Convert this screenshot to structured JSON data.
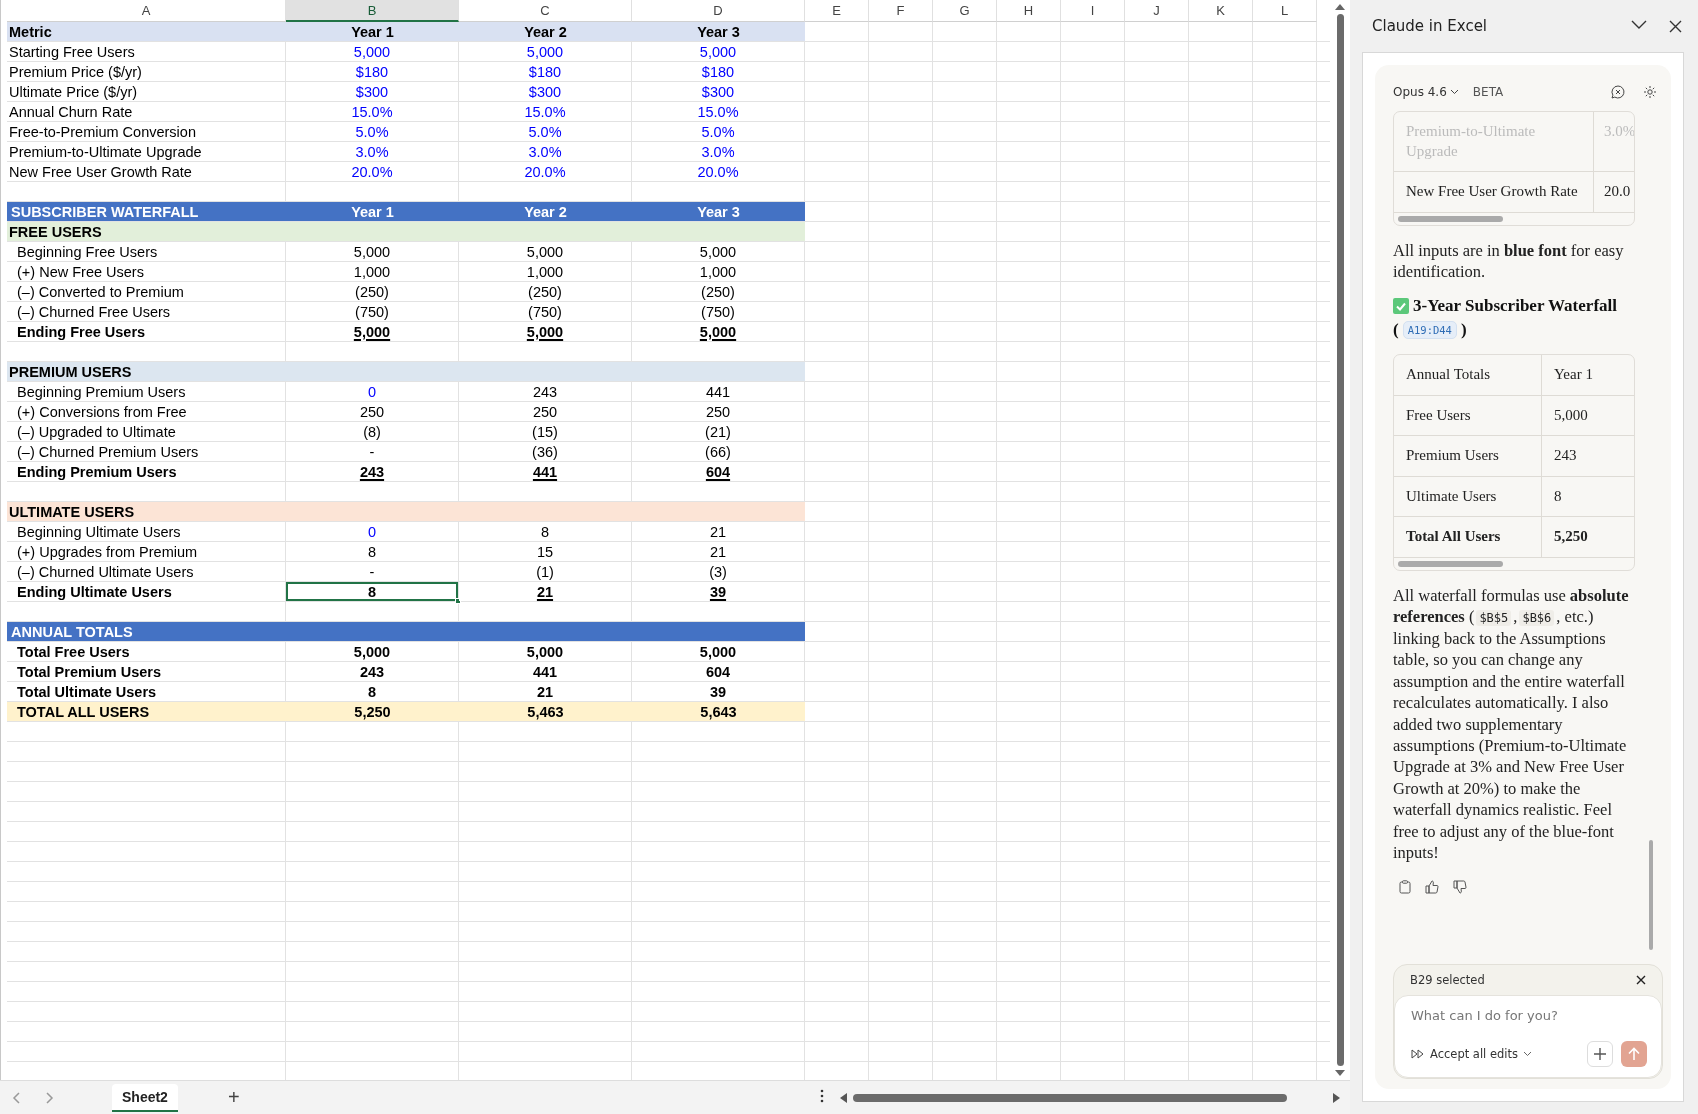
{
  "sheet": {
    "columns": [
      {
        "label": "A",
        "selected": false
      },
      {
        "label": "B",
        "selected": true
      },
      {
        "label": "C",
        "selected": false
      },
      {
        "label": "D",
        "selected": false
      },
      {
        "label": "E",
        "selected": false
      },
      {
        "label": "F",
        "selected": false
      },
      {
        "label": "G",
        "selected": false
      },
      {
        "label": "H",
        "selected": false
      },
      {
        "label": "I",
        "selected": false
      },
      {
        "label": "J",
        "selected": false
      },
      {
        "label": "K",
        "selected": false
      },
      {
        "label": "L",
        "selected": false
      }
    ],
    "rows": [
      {
        "kind": "header",
        "label": "Metric",
        "values": [
          {
            "text": "Year 1",
            "input": false,
            "selected": false
          },
          {
            "text": "Year 2",
            "input": false,
            "selected": false
          },
          {
            "text": "Year 3",
            "input": false,
            "selected": false
          }
        ]
      },
      {
        "kind": "item",
        "label": "Starting Free Users",
        "values": [
          {
            "text": "5,000",
            "input": true,
            "selected": false
          },
          {
            "text": "5,000",
            "input": true,
            "selected": false
          },
          {
            "text": "5,000",
            "input": true,
            "selected": false
          }
        ]
      },
      {
        "kind": "item",
        "label": "Premium Price ($/yr)",
        "values": [
          {
            "text": "$180",
            "input": true,
            "selected": false
          },
          {
            "text": "$180",
            "input": true,
            "selected": false
          },
          {
            "text": "$180",
            "input": true,
            "selected": false
          }
        ]
      },
      {
        "kind": "item",
        "label": "Ultimate Price ($/yr)",
        "values": [
          {
            "text": "$300",
            "input": true,
            "selected": false
          },
          {
            "text": "$300",
            "input": true,
            "selected": false
          },
          {
            "text": "$300",
            "input": true,
            "selected": false
          }
        ]
      },
      {
        "kind": "item",
        "label": "Annual Churn Rate",
        "values": [
          {
            "text": "15.0%",
            "input": true,
            "selected": false
          },
          {
            "text": "15.0%",
            "input": true,
            "selected": false
          },
          {
            "text": "15.0%",
            "input": true,
            "selected": false
          }
        ]
      },
      {
        "kind": "item",
        "label": "Free-to-Premium Conversion",
        "values": [
          {
            "text": "5.0%",
            "input": true,
            "selected": false
          },
          {
            "text": "5.0%",
            "input": true,
            "selected": false
          },
          {
            "text": "5.0%",
            "input": true,
            "selected": false
          }
        ]
      },
      {
        "kind": "item",
        "label": "Premium-to-Ultimate Upgrade",
        "values": [
          {
            "text": "3.0%",
            "input": true,
            "selected": false
          },
          {
            "text": "3.0%",
            "input": true,
            "selected": false
          },
          {
            "text": "3.0%",
            "input": true,
            "selected": false
          }
        ]
      },
      {
        "kind": "item",
        "label": "New Free User Growth Rate",
        "values": [
          {
            "text": "20.0%",
            "input": true,
            "selected": false
          },
          {
            "text": "20.0%",
            "input": true,
            "selected": false
          },
          {
            "text": "20.0%",
            "input": true,
            "selected": false
          }
        ]
      },
      {
        "kind": "blank"
      },
      {
        "kind": "section",
        "label": "SUBSCRIBER WATERFALL",
        "values": [
          {
            "text": "Year 1",
            "input": false,
            "selected": false
          },
          {
            "text": "Year 2",
            "input": false,
            "selected": false
          },
          {
            "text": "Year 3",
            "input": false,
            "selected": false
          }
        ]
      },
      {
        "kind": "group",
        "label": "FREE USERS",
        "color": "#e2efda"
      },
      {
        "kind": "line",
        "label": "Beginning Free Users",
        "values": [
          {
            "text": "5,000",
            "input": false,
            "selected": false
          },
          {
            "text": "5,000",
            "input": false,
            "selected": false
          },
          {
            "text": "5,000",
            "input": false,
            "selected": false
          }
        ]
      },
      {
        "kind": "line",
        "label": "(+) New Free Users",
        "values": [
          {
            "text": "1,000",
            "input": false,
            "selected": false
          },
          {
            "text": "1,000",
            "input": false,
            "selected": false
          },
          {
            "text": "1,000",
            "input": false,
            "selected": false
          }
        ]
      },
      {
        "kind": "line",
        "label": "(–) Converted to Premium",
        "values": [
          {
            "text": "(250)",
            "input": false,
            "selected": false
          },
          {
            "text": "(250)",
            "input": false,
            "selected": false
          },
          {
            "text": "(250)",
            "input": false,
            "selected": false
          }
        ]
      },
      {
        "kind": "line",
        "label": "(–) Churned Free Users",
        "values": [
          {
            "text": "(750)",
            "input": false,
            "selected": false
          },
          {
            "text": "(750)",
            "input": false,
            "selected": false
          },
          {
            "text": "(750)",
            "input": false,
            "selected": false
          }
        ]
      },
      {
        "kind": "total",
        "label": "Ending Free Users",
        "values": [
          {
            "text": "5,000",
            "input": false,
            "selected": false
          },
          {
            "text": "5,000",
            "input": false,
            "selected": false
          },
          {
            "text": "5,000",
            "input": false,
            "selected": false
          }
        ]
      },
      {
        "kind": "blank"
      },
      {
        "kind": "group",
        "label": "PREMIUM USERS",
        "color": "#dce6f0"
      },
      {
        "kind": "line",
        "label": "Beginning Premium Users",
        "values": [
          {
            "text": "0",
            "input": true,
            "selected": false
          },
          {
            "text": "243",
            "input": false,
            "selected": false
          },
          {
            "text": "441",
            "input": false,
            "selected": false
          }
        ]
      },
      {
        "kind": "line",
        "label": "(+) Conversions from Free",
        "values": [
          {
            "text": "250",
            "input": false,
            "selected": false
          },
          {
            "text": "250",
            "input": false,
            "selected": false
          },
          {
            "text": "250",
            "input": false,
            "selected": false
          }
        ]
      },
      {
        "kind": "line",
        "label": "(–) Upgraded to Ultimate",
        "values": [
          {
            "text": "(8)",
            "input": false,
            "selected": false
          },
          {
            "text": "(15)",
            "input": false,
            "selected": false
          },
          {
            "text": "(21)",
            "input": false,
            "selected": false
          }
        ]
      },
      {
        "kind": "line",
        "label": "(–) Churned Premium Users",
        "values": [
          {
            "text": "-",
            "input": false,
            "selected": false
          },
          {
            "text": "(36)",
            "input": false,
            "selected": false
          },
          {
            "text": "(66)",
            "input": false,
            "selected": false
          }
        ]
      },
      {
        "kind": "total",
        "label": "Ending Premium Users",
        "values": [
          {
            "text": "243",
            "input": false,
            "selected": false
          },
          {
            "text": "441",
            "input": false,
            "selected": false
          },
          {
            "text": "604",
            "input": false,
            "selected": false
          }
        ]
      },
      {
        "kind": "blank"
      },
      {
        "kind": "group",
        "label": "ULTIMATE USERS",
        "color": "#fce4d6"
      },
      {
        "kind": "line",
        "label": "Beginning Ultimate Users",
        "values": [
          {
            "text": "0",
            "input": true,
            "selected": false
          },
          {
            "text": "8",
            "input": false,
            "selected": false
          },
          {
            "text": "21",
            "input": false,
            "selected": false
          }
        ]
      },
      {
        "kind": "line",
        "label": "(+) Upgrades from Premium",
        "values": [
          {
            "text": "8",
            "input": false,
            "selected": false
          },
          {
            "text": "15",
            "input": false,
            "selected": false
          },
          {
            "text": "21",
            "input": false,
            "selected": false
          }
        ]
      },
      {
        "kind": "line",
        "label": "(–) Churned Ultimate Users",
        "values": [
          {
            "text": "-",
            "input": false,
            "selected": false
          },
          {
            "text": "(1)",
            "input": false,
            "selected": false
          },
          {
            "text": "(3)",
            "input": false,
            "selected": false
          }
        ]
      },
      {
        "kind": "total",
        "label": "Ending Ultimate Users",
        "values": [
          {
            "text": "8",
            "input": false,
            "selected": true
          },
          {
            "text": "21",
            "input": false,
            "selected": false
          },
          {
            "text": "39",
            "input": false,
            "selected": false
          }
        ]
      },
      {
        "kind": "blank"
      },
      {
        "kind": "section",
        "label": "ANNUAL TOTALS"
      },
      {
        "kind": "summary",
        "label": "Total Free Users",
        "values": [
          {
            "text": "5,000",
            "input": false,
            "selected": false
          },
          {
            "text": "5,000",
            "input": false,
            "selected": false
          },
          {
            "text": "5,000",
            "input": false,
            "selected": false
          }
        ]
      },
      {
        "kind": "summary",
        "label": "Total Premium Users",
        "values": [
          {
            "text": "243",
            "input": false,
            "selected": false
          },
          {
            "text": "441",
            "input": false,
            "selected": false
          },
          {
            "text": "604",
            "input": false,
            "selected": false
          }
        ]
      },
      {
        "kind": "summary",
        "label": "Total Ultimate Users",
        "values": [
          {
            "text": "8",
            "input": false,
            "selected": false
          },
          {
            "text": "21",
            "input": false,
            "selected": false
          },
          {
            "text": "39",
            "input": false,
            "selected": false
          }
        ]
      },
      {
        "kind": "grand",
        "label": "TOTAL ALL USERS",
        "color": "#fff2cc",
        "values": [
          {
            "text": "5,250",
            "input": false,
            "selected": false
          },
          {
            "text": "5,463",
            "input": false,
            "selected": false
          },
          {
            "text": "5,643",
            "input": false,
            "selected": false
          }
        ]
      }
    ]
  },
  "sheet_tabs": [
    {
      "label": "Sheet2",
      "selected": true
    }
  ],
  "add_sheet": "+",
  "panel": {
    "title": "Claude in Excel",
    "model": "Opus 4.6",
    "badge": "BETA",
    "assumption_table": {
      "rows": [
        {
          "label": "Premium-to-Ultimate Upgrade",
          "value": "3.0%",
          "faded": true
        },
        {
          "label": "New Free User Growth Rate",
          "value": "20.0",
          "faded": false
        }
      ]
    },
    "note": "All inputs are in **blue font** for easy identification.",
    "heading": "3-Year Subscriber Waterfall",
    "range_open": "(",
    "range": "A19:D44",
    "range_close": ")",
    "totals_table": {
      "columns": [
        "Annual Totals",
        "Year 1"
      ],
      "rows": [
        {
          "label": "Free Users",
          "value": "5,000",
          "bold": false
        },
        {
          "label": "Premium Users",
          "value": "243",
          "bold": false
        },
        {
          "label": "Ultimate Users",
          "value": "8",
          "bold": false
        },
        {
          "label": "Total All Users",
          "value": "5,250",
          "bold": true
        }
      ]
    },
    "message": [
      {
        "kind": "text",
        "text": "All waterfall formulas use **absolute references** ("
      },
      {
        "kind": "code",
        "text": "$B$5"
      },
      {
        "kind": "text",
        "text": ","
      },
      {
        "kind": "code",
        "text": "$B$6"
      },
      {
        "kind": "text",
        "text": ", etc.) linking back to the Assumptions table, so you can change any assumption and the entire waterfall recalculates automatically. I also added two supplementary assumptions (Premium-to-Ultimate Upgrade at 3% and New Free User Growth at 20%) to make the waterfall dynamics realistic. Feel free to adjust any of the blue-font inputs!"
      }
    ],
    "context": "B29 selected",
    "placeholder": "What can I do for you?",
    "accept": "Accept all edits"
  }
}
